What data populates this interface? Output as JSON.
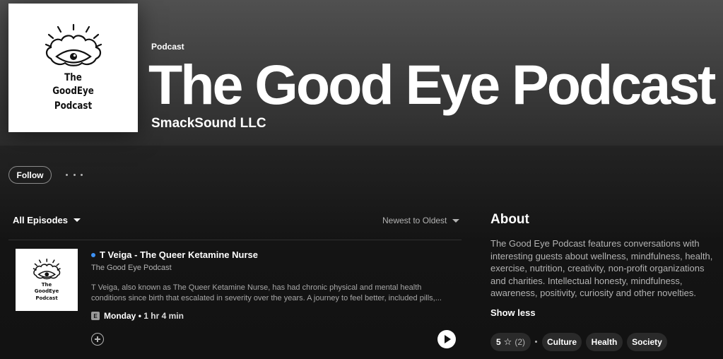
{
  "podcast": {
    "type_label": "Podcast",
    "title": "The Good Eye Podcast",
    "publisher": "SmackSound LLC",
    "cover_lines": [
      "The",
      "GoodEye",
      "Podcast"
    ]
  },
  "actions": {
    "follow_label": "Follow",
    "more_icon": "more-options-icon"
  },
  "episodes_header": {
    "filter_label": "All Episodes",
    "sort_label": "Newest to Oldest"
  },
  "episodes": [
    {
      "title": "T Veiga - The Queer Ketamine Nurse",
      "show": "The Good Eye Podcast",
      "description": "T Veiga, also known as The Queer Ketamine Nurse, has had chronic physical and mental health conditions since birth that escalated in severity over the years.  A journey to feel better, included pills,...",
      "explicit_badge": "E",
      "date": "Monday",
      "duration": "1 hr 4 min",
      "is_new": true
    }
  ],
  "about": {
    "heading": "About",
    "text": "The Good Eye Podcast features conversations with interesting guests about wellness, mindfulness, health, exercise, nutrition, creativity, non-profit organizations and charities.  Intellectual honesty, mindfulness, awareness, positivity, curiosity and other novelties.",
    "show_less_label": "Show less",
    "rating_value": "5",
    "rating_count": "(2)",
    "tags": [
      "Culture",
      "Health",
      "Society"
    ]
  },
  "colors": {
    "accent_blue": "#3d91f4",
    "cover_blue": "#3a8fc7",
    "background": "#121212"
  }
}
